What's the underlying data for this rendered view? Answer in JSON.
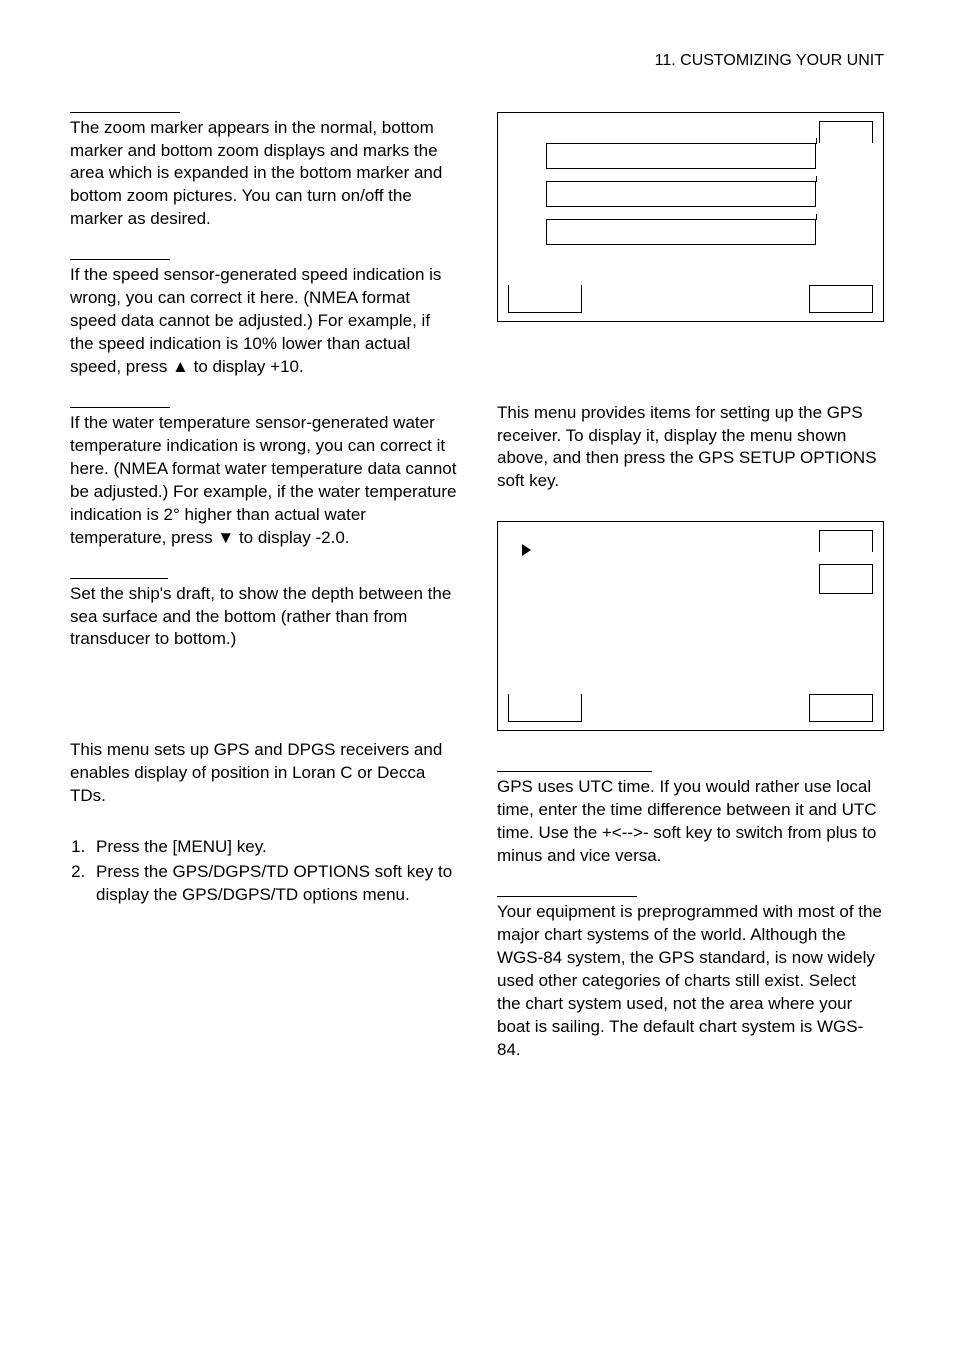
{
  "header": "11. CUSTOMIZING YOUR UNIT",
  "left": {
    "zoom_marker": "The zoom marker appears in the normal, bottom marker and bottom zoom displays and marks the area which is expanded in the bottom marker and bottom zoom pictures. You can turn on/off the marker as desired.",
    "speed_sensor": "If the speed sensor-generated speed indication is wrong, you can correct it here. (NMEA format speed data cannot be adjusted.) For example, if the speed indication is 10% lower than actual speed, press ▲ to display +10.",
    "temp_sensor": "If the water temperature sensor-generated water temperature indication is wrong, you can correct it here. (NMEA format water temperature data cannot be adjusted.) For example, if the water temperature indication is 2° higher than actual water temperature, press ▼ to display -2.0.",
    "draft": "Set the ship's draft, to show the depth between the sea surface and the bottom (rather than from transducer to bottom.)",
    "gps_dpgs_intro": "This menu sets up GPS and DPGS receivers and enables display of position in Loran C or Decca TDs.",
    "step1": "Press the [MENU] key.",
    "step2": "Press the GPS/DGPS/TD OPTIONS soft key to display the GPS/DGPS/TD options menu."
  },
  "right": {
    "gps_setup_intro": "This menu provides items for setting up the GPS receiver. To display it, display the menu shown above, and then press the GPS SETUP OPTIONS soft key.",
    "local_time": "GPS uses UTC time. If you would rather use local time, enter the time difference between it and UTC time. Use the +<-->- soft key to switch from plus to minus and vice versa.",
    "geodetic": "Your equipment is preprogrammed with most of the major chart systems of the world. Although the WGS-84 system, the GPS standard, is now widely used other categories of charts still exist. Select the chart system used, not the area where your boat is sailing. The default chart system is WGS-84."
  }
}
